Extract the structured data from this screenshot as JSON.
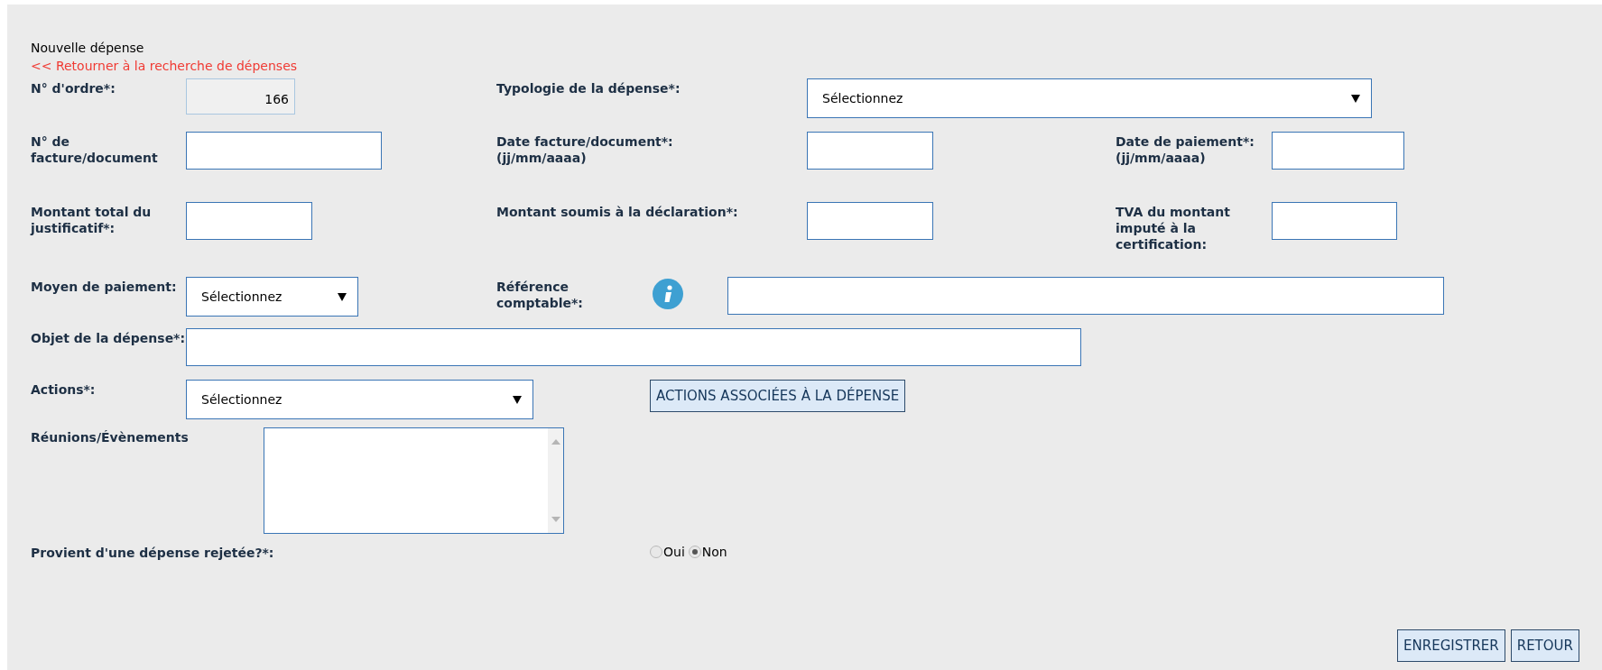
{
  "title": "Nouvelle dépense",
  "back_link": "<< Retourner à la recherche de dépenses",
  "order_number": {
    "label": "N° d'ordre*:",
    "value": "166",
    "disabled": true
  },
  "typology": {
    "label": "Typologie de la dépense*:",
    "value": "Sélectionnez"
  },
  "invoice_number": {
    "label": "N° de facture/document"
  },
  "invoice_date": {
    "label": "Date facture/document*:",
    "hint": "(jj/mm/aaaa)"
  },
  "payment_date": {
    "label": "Date de paiement*:",
    "hint": "(jj/mm/aaaa)"
  },
  "total_amount": {
    "label": "Montant total du justificatif*:"
  },
  "declared_amount": {
    "label": "Montant soumis à la déclaration*:"
  },
  "vat": {
    "label": "TVA du montant imputé à la certification:"
  },
  "payment_method": {
    "label": "Moyen de paiement:",
    "value": "Sélectionnez"
  },
  "accounting_ref": {
    "label": "Référence comptable*:"
  },
  "purpose": {
    "label": "Objet de la dépense*:"
  },
  "actions": {
    "label": "Actions*:",
    "value": "Sélectionnez",
    "button": "ACTIONS ASSOCIÉES À LA DÉPENSE"
  },
  "meetings": {
    "label": "Réunions/Évènements"
  },
  "rejected": {
    "label": "Provient d'une dépense rejetée?*:",
    "options": [
      {
        "label": "Oui",
        "selected": false
      },
      {
        "label": "Non",
        "selected": true
      }
    ]
  },
  "buttons": [
    "ENREGISTRER",
    "RETOUR"
  ]
}
